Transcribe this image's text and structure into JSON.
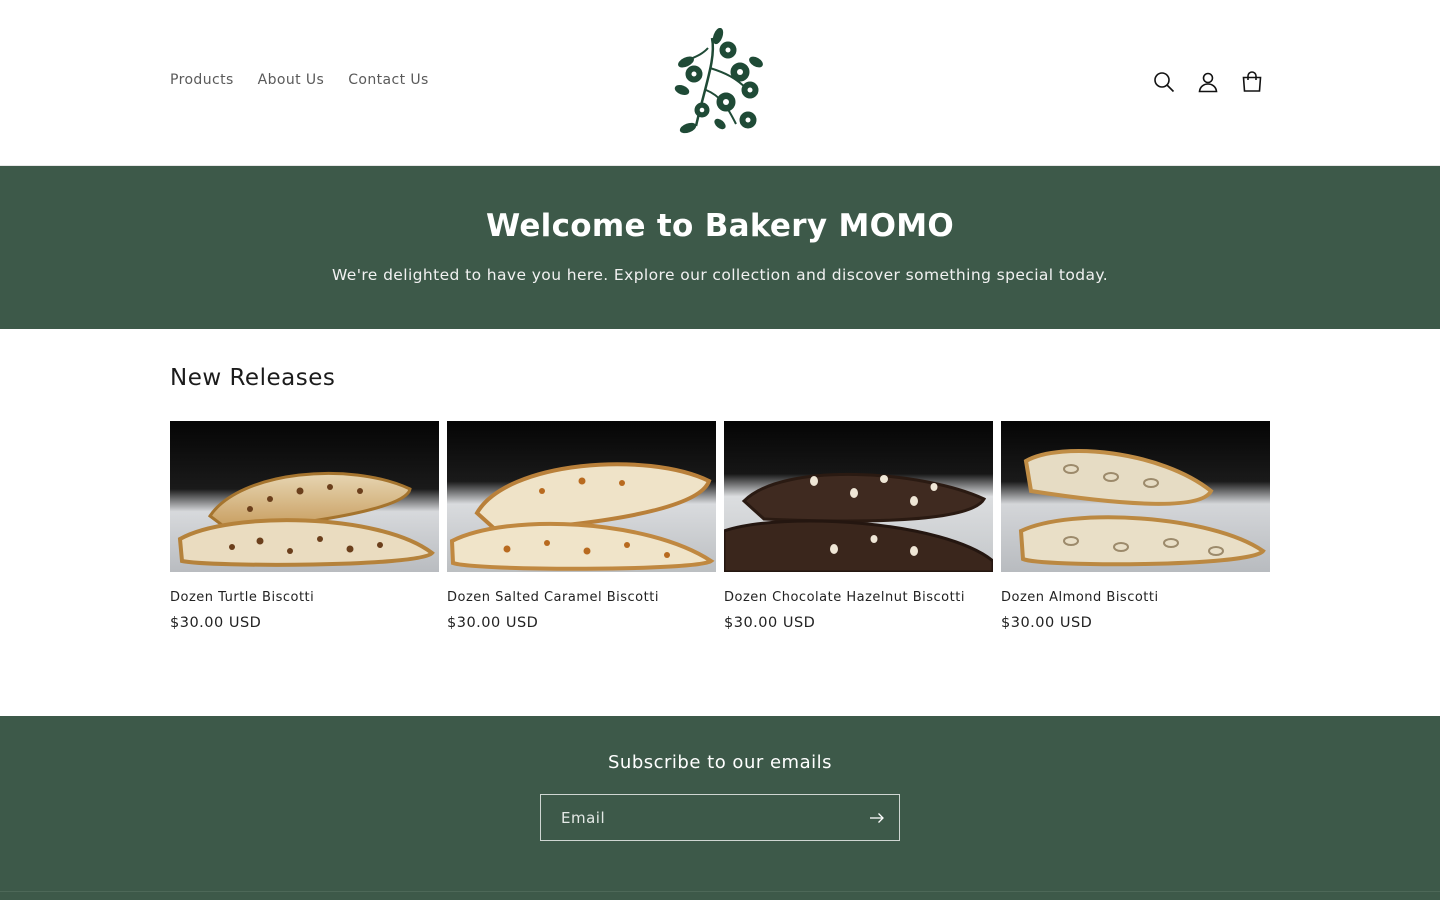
{
  "header": {
    "nav": [
      "Products",
      "About Us",
      "Contact Us"
    ],
    "logo_icon": "floral-branch-logo",
    "icons": [
      "search-icon",
      "account-icon",
      "cart-icon"
    ],
    "brand_color": "#1f4a36"
  },
  "hero": {
    "title": "Welcome to Bakery MOMO",
    "subtitle": "We're delighted to have you here. Explore our collection and discover something special today.",
    "background": "#3d5949"
  },
  "releases": {
    "heading": "New Releases",
    "products": [
      {
        "title": "Dozen Turtle Biscotti",
        "price": "$30.00 USD",
        "variant": "light-chip"
      },
      {
        "title": "Dozen Salted Caramel Biscotti",
        "price": "$30.00 USD",
        "variant": "light-caramel"
      },
      {
        "title": "Dozen Chocolate Hazelnut Biscotti",
        "price": "$30.00 USD",
        "variant": "dark-nut"
      },
      {
        "title": "Dozen Almond Biscotti",
        "price": "$30.00 USD",
        "variant": "light-almond"
      }
    ]
  },
  "subscribe": {
    "heading": "Subscribe to our emails",
    "email_placeholder": "Email",
    "submit_icon": "arrow-right-icon",
    "background": "#3d5949"
  }
}
